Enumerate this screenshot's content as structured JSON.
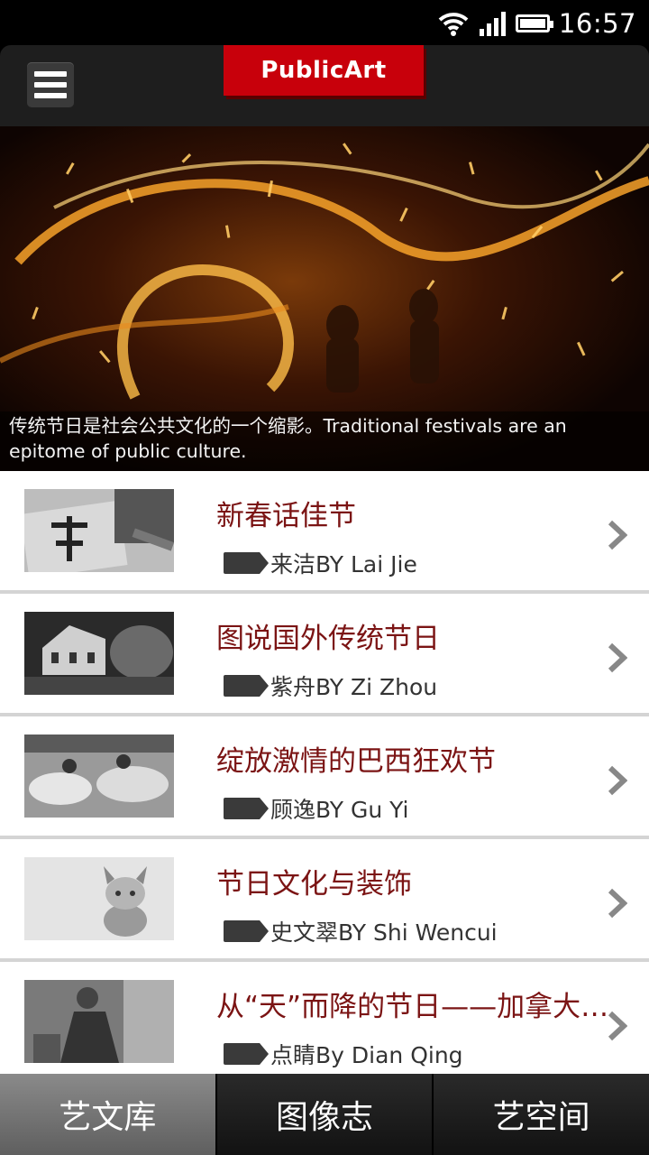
{
  "status_bar": {
    "time": "16:57"
  },
  "header": {
    "logo_text": "PublicArt"
  },
  "hero": {
    "caption": "传统节日是社会公共文化的一个缩影。Traditional festivals are an epitome of public culture."
  },
  "articles": [
    {
      "title": "新春话佳节",
      "author": "来洁BY Lai Jie"
    },
    {
      "title": "图说国外传统节日",
      "author": "紫舟BY Zi Zhou"
    },
    {
      "title": "绽放激情的巴西狂欢节",
      "author": "顾逸BY Gu Yi"
    },
    {
      "title": "节日文化与装饰",
      "author": "史文翠BY Shi Wencui"
    },
    {
      "title": "从“天”而降的节日——加拿大枫叶节",
      "author": "点睛By Dian Qing"
    }
  ],
  "bottom_nav": {
    "tabs": [
      {
        "label": "艺文库",
        "active": true
      },
      {
        "label": "图像志",
        "active": false
      },
      {
        "label": "艺空间",
        "active": false
      }
    ]
  },
  "colors": {
    "brand": "#c8000b",
    "title_text": "#7b1414"
  }
}
